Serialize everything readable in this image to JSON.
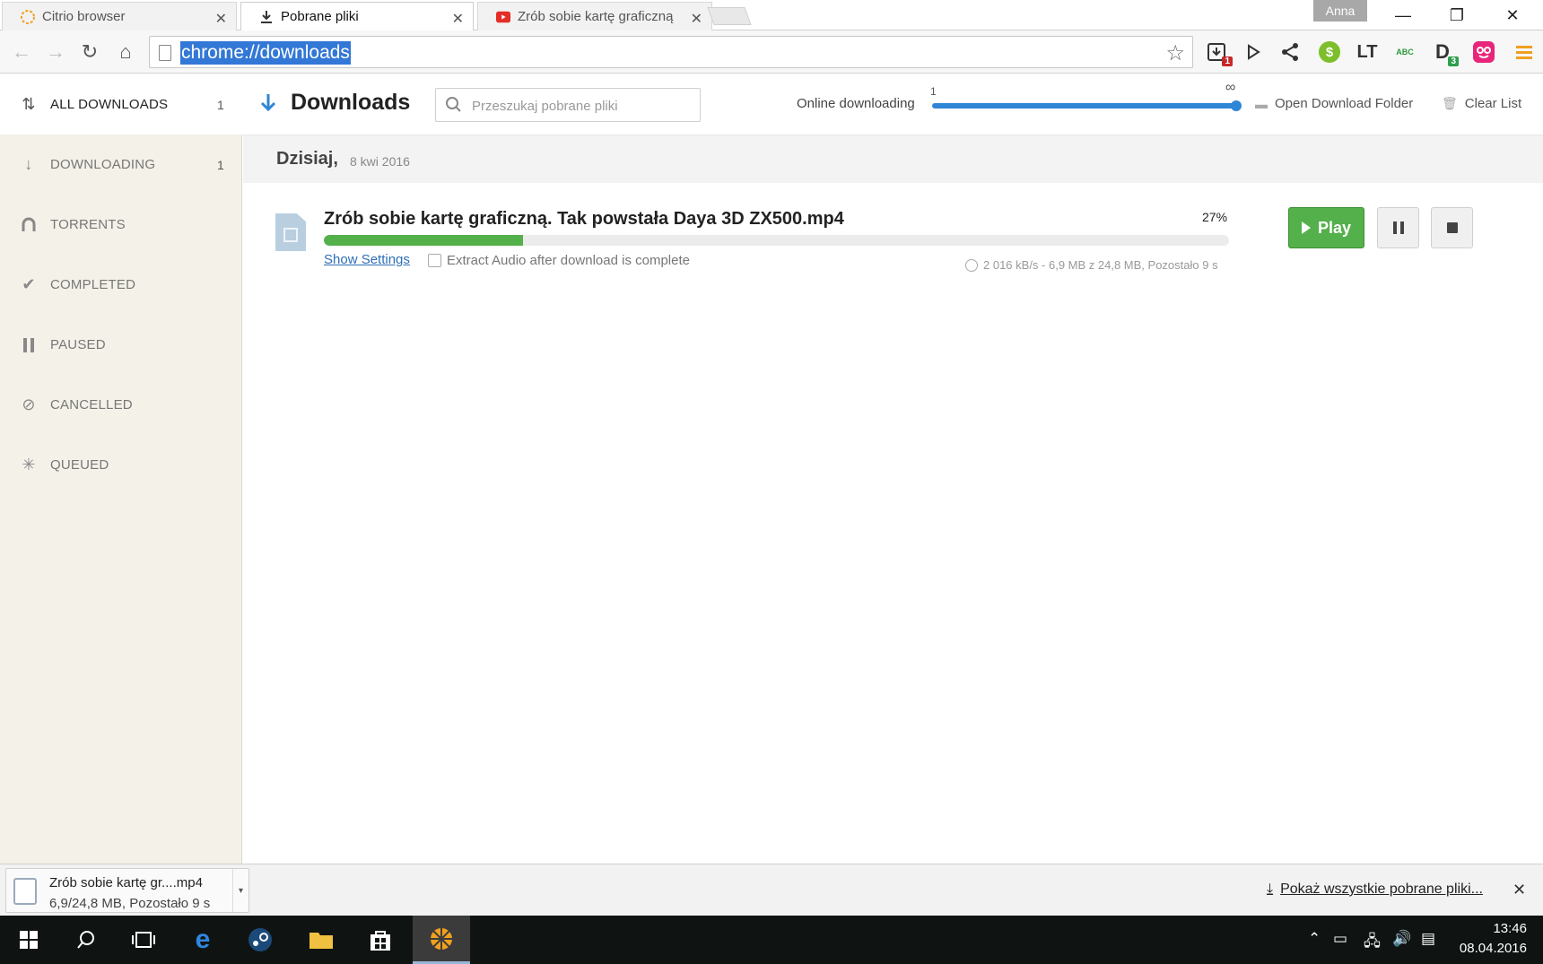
{
  "browser": {
    "tabs": [
      {
        "label": "Citrio browser",
        "icon": "citrio-icon"
      },
      {
        "label": "Pobrane pliki",
        "icon": "download-icon"
      },
      {
        "label": "Zrób sobie kartę graficzną",
        "icon": "youtube-icon"
      }
    ],
    "profile_name": "Anna",
    "url": "chrome://downloads",
    "extensions": [
      {
        "name": "download-manager-icon",
        "badge": "1"
      },
      {
        "name": "play-icon"
      },
      {
        "name": "share-icon"
      },
      {
        "name": "dollar-icon"
      },
      {
        "name": "languagetool-icon",
        "text": "LT"
      },
      {
        "name": "spellcheck-icon",
        "text": "ABC"
      },
      {
        "name": "d-extension-icon",
        "text": "D",
        "badge": "3"
      },
      {
        "name": "pocket-icon"
      },
      {
        "name": "menu-icon"
      }
    ]
  },
  "sidebar": {
    "items": [
      {
        "label": "ALL DOWNLOADS",
        "count": "1",
        "icon": "all-downloads-icon"
      },
      {
        "label": "DOWNLOADING",
        "count": "1",
        "icon": "arrow-down-icon"
      },
      {
        "label": "TORRENTS",
        "count": "",
        "icon": "magnet-icon"
      },
      {
        "label": "COMPLETED",
        "count": "",
        "icon": "check-icon"
      },
      {
        "label": "PAUSED",
        "count": "",
        "icon": "pause-icon"
      },
      {
        "label": "CANCELLED",
        "count": "",
        "icon": "cancel-icon"
      },
      {
        "label": "QUEUED",
        "count": "",
        "icon": "spinner-icon"
      }
    ]
  },
  "header": {
    "title": "Downloads",
    "search_placeholder": "Przeszukaj pobrane pliki",
    "online_label": "Online downloading",
    "slider_min": "1",
    "slider_max": "∞",
    "open_folder": "Open Download Folder",
    "clear_list": "Clear List"
  },
  "date_group": {
    "day": "Dzisiaj,",
    "date": "8 kwi 2016"
  },
  "download": {
    "file_name": "Zrób sobie kartę graficzną. Tak powstała Daya 3D ZX500.mp4",
    "percent_label": "27%",
    "progress": 0.22,
    "show_settings": "Show Settings",
    "extract_audio_label": "Extract Audio after download is complete",
    "stats": "2 016 kB/s - 6,9 MB z 24,8 MB, Pozostało 9 s",
    "play_label": "Play",
    "accent_color": "#54b04a"
  },
  "shelf": {
    "file_name": "Zrób sobie kartę gr....mp4",
    "status": "6,9/24,8 MB, Pozostało 9 s",
    "show_all": "Pokaż wszystkie pobrane pliki..."
  },
  "taskbar": {
    "time": "13:46",
    "date": "08.04.2016"
  }
}
